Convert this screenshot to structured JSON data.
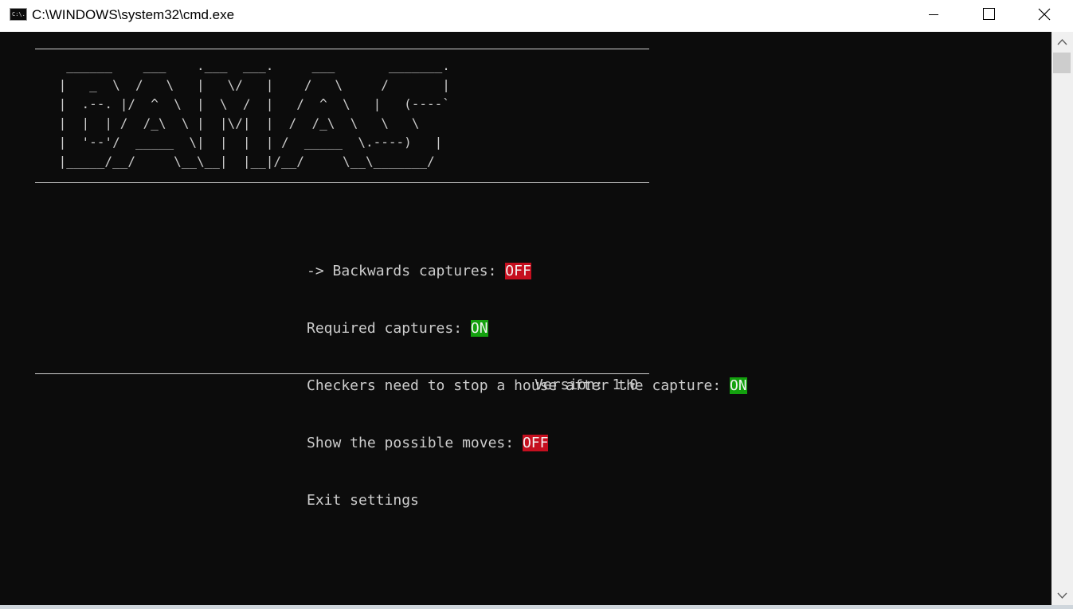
{
  "window": {
    "title": "C:\\WINDOWS\\system32\\cmd.exe",
    "icon_text": "C:\\."
  },
  "icons": {
    "app": "cmd-icon",
    "minimize": "minimize-icon",
    "maximize": "maximize-icon",
    "close": "close-icon",
    "scroll_up": "chevron-up-icon",
    "scroll_down": "chevron-down-icon"
  },
  "banner": {
    "ascii_art": "  ______    ___    .___  ___.     ___       _______.\n |   _  \\  /   \\   |   \\/   |    /   \\     /       |\n |  .--. |/  ^  \\  |  \\  /  |   /  ^  \\   |   (----`\n |  |  | /  /_\\  \\ |  |\\/|  |  /  /_\\  \\   \\   \\\n |  '--'/  _____  \\|  |  |  | /  _____  \\.----)   |\n |_____/__/     \\__\\__|  |__|/__/     \\__\\_______/"
  },
  "menu": {
    "items": [
      {
        "prefix": "-> ",
        "label": "Backwards captures: ",
        "value": "OFF",
        "state": "off"
      },
      {
        "prefix": "",
        "label": "Required captures: ",
        "value": "ON",
        "state": "on"
      },
      {
        "prefix": "",
        "label": "Checkers need to stop a house after the capture: ",
        "value": "ON",
        "state": "on"
      },
      {
        "prefix": "",
        "label": "Show the possible moves: ",
        "value": "OFF",
        "state": "off"
      },
      {
        "prefix": "",
        "label": "Exit settings",
        "value": "",
        "state": "none"
      }
    ]
  },
  "footer": {
    "version": "Version: 1.0"
  },
  "colors": {
    "console_bg": "#0c0c0c",
    "console_text": "#cccccc",
    "off_badge": "#c50f1f",
    "on_badge": "#13a10e"
  }
}
